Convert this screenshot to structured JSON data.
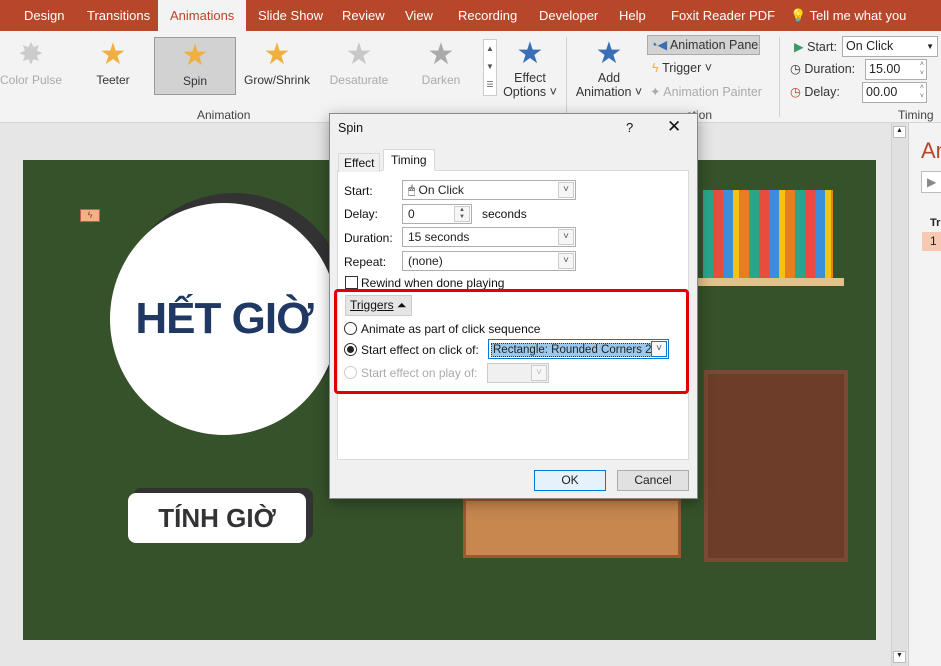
{
  "tabs": [
    "Design",
    "Transitions",
    "Animations",
    "Slide Show",
    "Review",
    "View",
    "Recording",
    "Developer",
    "Help",
    "Foxit Reader PDF"
  ],
  "tell_me": "Tell me what you want t",
  "gallery": [
    {
      "label": "Color Pulse",
      "state": "dim"
    },
    {
      "label": "Teeter",
      "state": ""
    },
    {
      "label": "Spin",
      "state": "selected"
    },
    {
      "label": "Grow/Shrink",
      "state": ""
    },
    {
      "label": "Desaturate",
      "state": "dim"
    },
    {
      "label": "Darken",
      "state": "dim"
    }
  ],
  "groups": {
    "animation": "Animation",
    "advanced": "ation",
    "timing": "Timing"
  },
  "ribbon": {
    "effect_options": [
      "Effect",
      "Options"
    ],
    "add_animation": [
      "Add",
      "Animation"
    ],
    "animation_pane": "Animation Pane",
    "trigger": "Trigger",
    "animation_painter": "Animation Painter",
    "start_label": "Start:",
    "start_value": "On Click",
    "duration_label": "Duration:",
    "duration_value": "15.00",
    "delay_label": "Delay:",
    "delay_value": "00.00"
  },
  "pane": {
    "title": "An",
    "trigger_label": "Tri",
    "item": "1"
  },
  "slide": {
    "title": "HẾT GIỜ",
    "button": "TÍNH GIỜ"
  },
  "dialog": {
    "title": "Spin",
    "help": "?",
    "tabs": [
      "Effect",
      "Timing"
    ],
    "active_tab": "Timing",
    "start_label": "Start:",
    "start_value": "On Click",
    "delay_label": "Delay:",
    "delay_value": "0",
    "delay_unit": "seconds",
    "duration_label": "Duration:",
    "duration_value": "15 seconds",
    "repeat_label": "Repeat:",
    "repeat_value": "(none)",
    "rewind": "Rewind when done playing",
    "rewind_checked": false,
    "triggers_button": "Triggers",
    "opt_sequence": "Animate as part of click sequence",
    "opt_click": "Start effect on click of:",
    "opt_click_value": "Rectangle: Rounded Corners 2",
    "opt_play": "Start effect on play of:",
    "selected_option": "click",
    "ok": "OK",
    "cancel": "Cancel"
  },
  "colors": {
    "accent": "#b7472a",
    "slide_bg": "#36522a",
    "highlight": "#e00000",
    "title_text": "#1f3864"
  }
}
